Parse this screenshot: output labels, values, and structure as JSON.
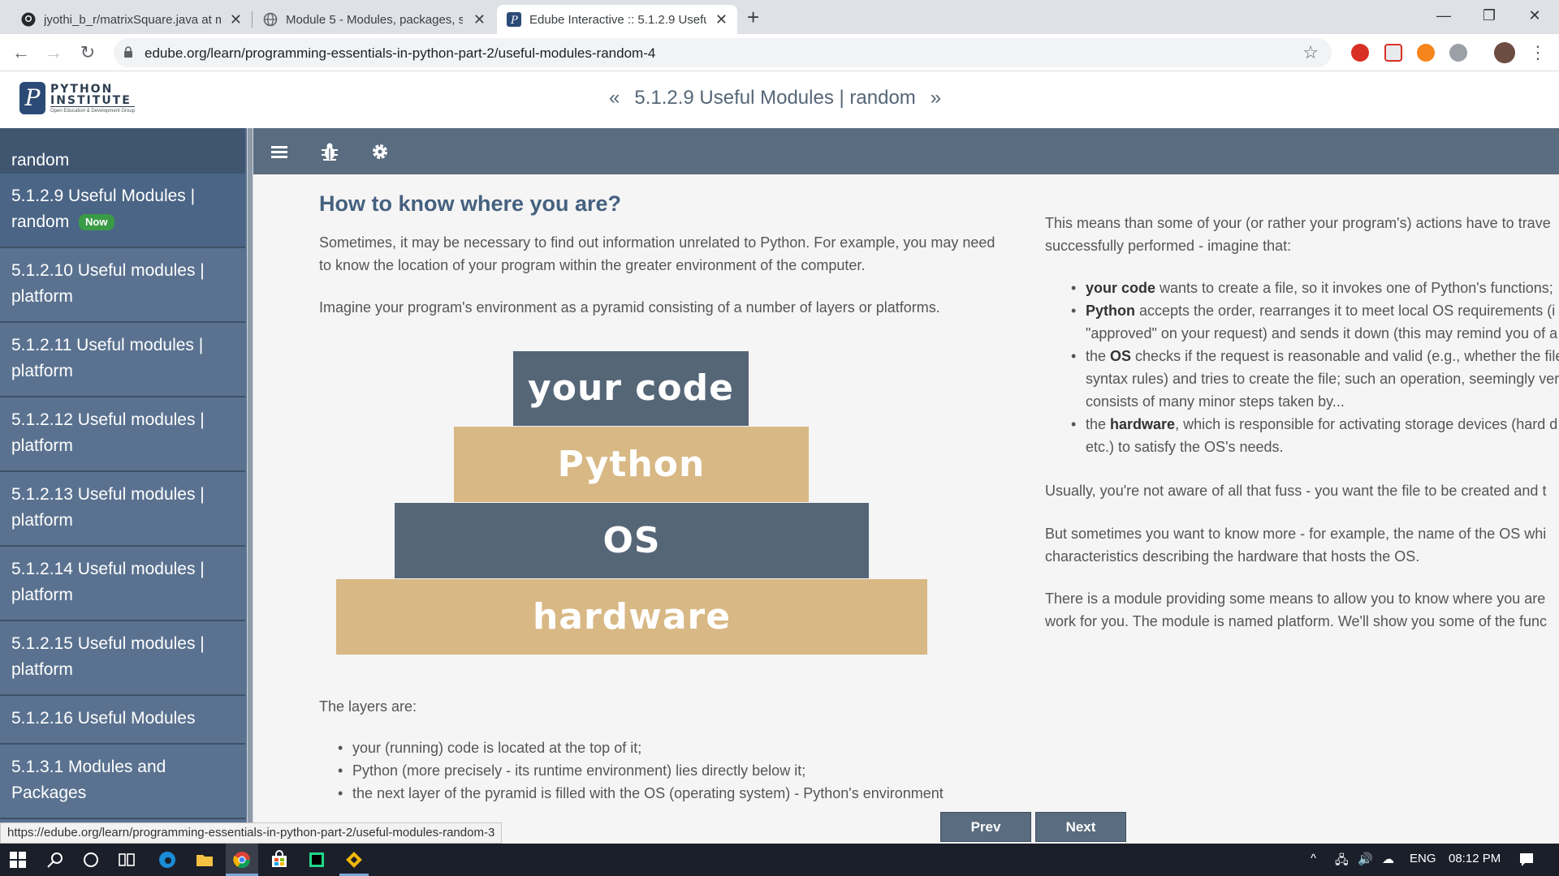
{
  "browser": {
    "tabs": [
      {
        "title": "jyothi_b_r/matrixSquare.java at m",
        "icon": "github-icon"
      },
      {
        "title": "Module 5 - Modules, packages, s",
        "icon": "globe-icon"
      },
      {
        "title": "Edube Interactive :: 5.1.2.9 Useful",
        "icon": "python-institute-icon",
        "active": true
      }
    ],
    "url": "edube.org/learn/programming-essentials-in-python-part-2/useful-modules-random-4"
  },
  "header": {
    "logo": {
      "line1": "PYTHON",
      "line2": "INSTITUTE",
      "line3": "Open Education & Development Group"
    },
    "title": "5.1.2.9 Useful Modules | random",
    "prev_chevron": "«",
    "next_chevron": "»"
  },
  "sidebar": {
    "items": [
      {
        "label": "random"
      },
      {
        "label": "5.1.2.9 Useful Modules | random",
        "badge": "Now"
      },
      {
        "label": "5.1.2.10 Useful modules | platform"
      },
      {
        "label": "5.1.2.11 Useful modules | platform"
      },
      {
        "label": "5.1.2.12 Useful modules | platform"
      },
      {
        "label": "5.1.2.13 Useful modules | platform"
      },
      {
        "label": "5.1.2.14 Useful modules | platform"
      },
      {
        "label": "5.1.2.15 Useful modules | platform"
      },
      {
        "label": "5.1.2.16 Useful Modules"
      },
      {
        "label": "5.1.3.1 Modules and Packages"
      }
    ]
  },
  "content": {
    "heading": "How to know where you are?",
    "intro1a": "Sometimes, it may be necessary to find out information unrelated to Python. For example, you may need",
    "intro1b": "to know the location of your program within the greater environment of the computer.",
    "intro2": "Imagine your program's environment as a pyramid consisting of a number of layers or platforms.",
    "pyramid": [
      "your code",
      "Python",
      "OS",
      "hardware"
    ],
    "layers_intro": "The layers are:",
    "layers": [
      "your (running) code is located at the top of it;",
      "Python (more precisely - its runtime environment) lies directly below it;",
      "the next layer of the pyramid is filled with the OS (operating system) - Python's environment"
    ],
    "right": {
      "p1a": "This means than some of your (or rather your program's) actions have to trave",
      "p1b": "successfully performed - imagine that:",
      "bullets": [
        {
          "bold": "your code",
          "rest": " wants to create a file, so it invokes one of Python's functions;"
        },
        {
          "bold": "Python",
          "rest": " accepts the order, rearranges it to meet local OS requirements (i",
          "cont": [
            "\"approved\" on your request) and sends it down (this may remind you of a"
          ]
        },
        {
          "pre": "the ",
          "bold": "OS",
          "rest": " checks if the request is reasonable and valid (e.g., whether the file",
          "cont": [
            "syntax rules) and tries to create the file; such an operation, seemingly ver",
            "consists of many minor steps taken by..."
          ]
        },
        {
          "pre": "the ",
          "bold": "hardware",
          "rest": ", which is responsible for activating storage devices (hard d",
          "cont": [
            "etc.) to satisfy the OS's needs."
          ]
        }
      ],
      "p2": "Usually, you're not aware of all that fuss - you want the file to be created and t",
      "p3a": "But sometimes you want to know more - for example, the name of the OS whi",
      "p3b": "characteristics describing the hardware that hosts the OS.",
      "p4a": "There is a module providing some means to allow you to know where you are",
      "p4b": "work for you. The module is named platform. We'll show you some of the func"
    }
  },
  "footer": {
    "prev": "Prev",
    "next": "Next"
  },
  "status_url": "https://edube.org/learn/programming-essentials-in-python-part-2/useful-modules-random-3",
  "taskbar": {
    "lang": "ENG",
    "time": "08:12 PM"
  }
}
